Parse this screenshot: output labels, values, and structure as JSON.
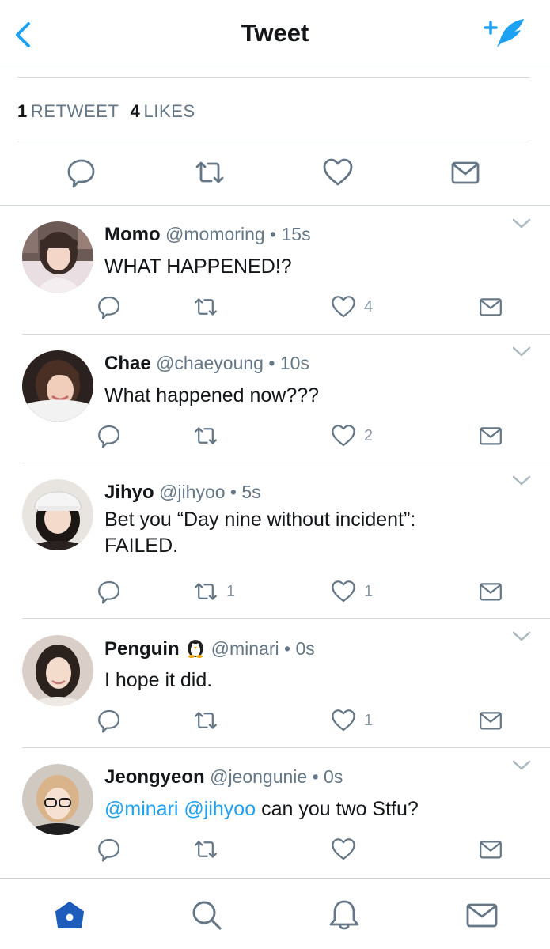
{
  "header": {
    "title": "Tweet"
  },
  "stats": {
    "retweets_count": "1",
    "retweets_label": "RETWEET",
    "likes_count": "4",
    "likes_label": "LIKES"
  },
  "colors": {
    "accent": "#1da1f2",
    "text": "#14171a",
    "muted": "#657786",
    "icon": "#657786",
    "divider": "#d6d9dc",
    "home_active": "#1d5cba"
  },
  "replies": [
    {
      "name": "Momo",
      "handle": "@momoring",
      "time": "15s",
      "text": "WHAT HAPPENED!?",
      "retweets": "",
      "likes": "4"
    },
    {
      "name": "Chae",
      "handle": "@chaeyoung",
      "time": "10s",
      "text": "What happened now???",
      "retweets": "",
      "likes": "2"
    },
    {
      "name": "Jihyo",
      "handle": "@jihyoo",
      "time": "5s",
      "text": "Bet you “Day nine without incident”: FAILED.",
      "retweets": "1",
      "likes": "1"
    },
    {
      "name": "Penguin",
      "handle": "@minari",
      "time": "0s",
      "text": "I hope it did.",
      "retweets": "",
      "likes": "1",
      "name_emoji": "penguin-emoji"
    },
    {
      "name": "Jeongyeon",
      "handle": "@jeongunie",
      "time": "0s",
      "mention1": "@minari",
      "mention2": "@jihyoo",
      "text": "can you two Stfu?",
      "retweets": "",
      "likes": ""
    }
  ],
  "time_sep": "•",
  "icons": {
    "back": "chevron-left-icon",
    "compose": "compose-tweet-icon",
    "reply": "reply-icon",
    "retweet": "retweet-icon",
    "like": "heart-icon",
    "dm": "mail-icon",
    "caret": "chevron-down-icon",
    "tabs": [
      "home-icon",
      "search-icon",
      "notifications-icon",
      "messages-icon"
    ]
  }
}
